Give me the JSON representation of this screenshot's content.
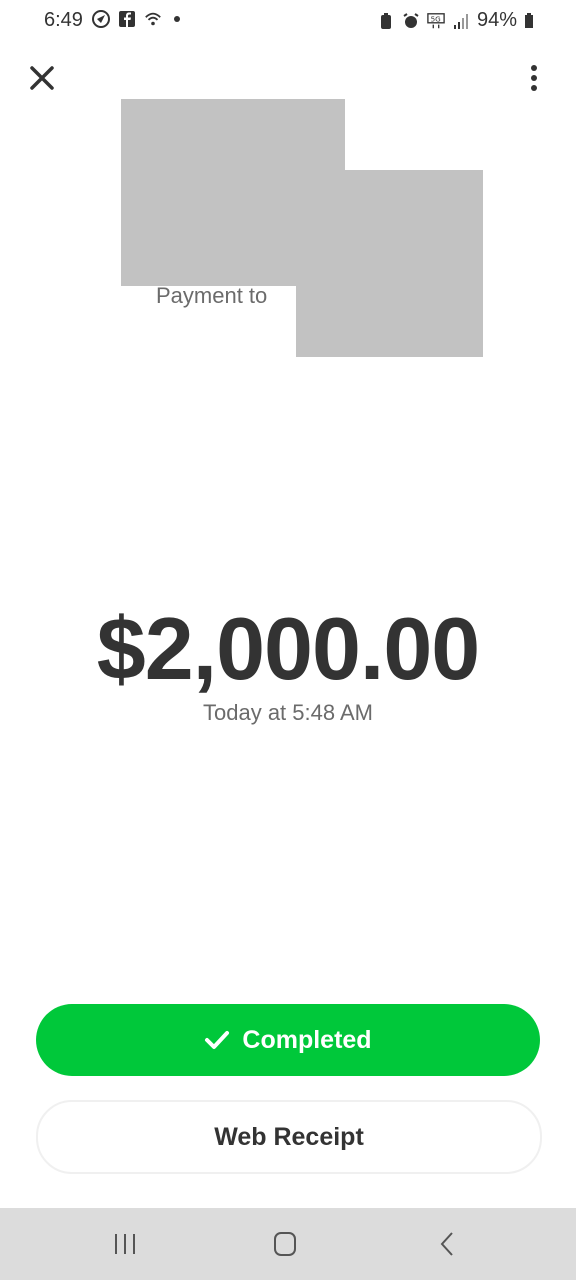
{
  "status_bar": {
    "time": "6:49",
    "battery": "94%",
    "network": "5G"
  },
  "header": {
    "close_icon": "close-icon",
    "more_icon": "more-vertical-icon"
  },
  "payment": {
    "to_label": "Payment to",
    "amount": "$2,000.00",
    "date": "Today at 5:48 AM"
  },
  "actions": {
    "completed_label": "Completed",
    "completed_color": "#00c83a",
    "receipt_label": "Web Receipt"
  },
  "nav": {
    "recent_icon": "recent-apps-icon",
    "home_icon": "home-icon",
    "back_icon": "back-icon"
  }
}
